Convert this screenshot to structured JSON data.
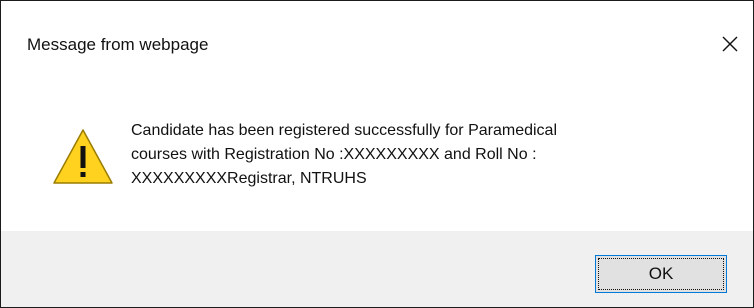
{
  "dialog": {
    "title": "Message from webpage",
    "close_icon": "close-icon",
    "icon": "warning-icon",
    "message_lines": [
      "Candidate has been registered successfully for Paramedical",
      "courses with Registration No :XXXXXXXXX and Roll No :",
      "XXXXXXXXXRegistrar, NTRUHS"
    ],
    "ok_label": "OK",
    "colors": {
      "warning_fill": "#FFD21F",
      "warning_stroke": "#9A7C00",
      "footer_bg": "#F0F0F0",
      "button_border": "#0078D7"
    }
  }
}
